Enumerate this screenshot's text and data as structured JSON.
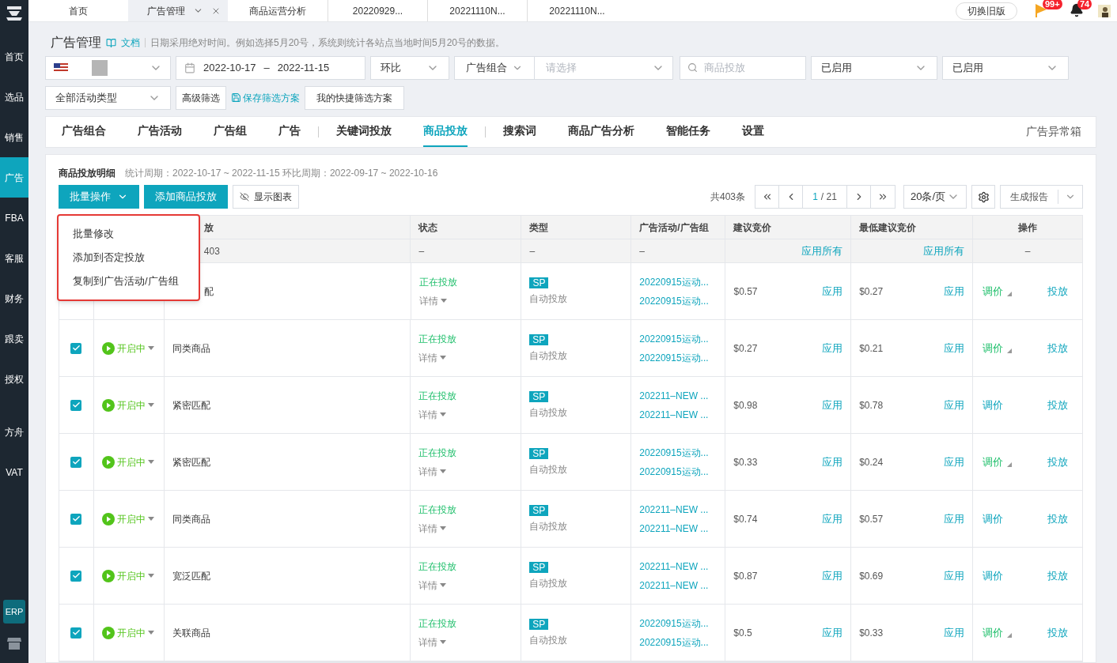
{
  "sidebar": {
    "items": [
      {
        "label": "首页",
        "selected": false
      },
      {
        "label": "选品",
        "selected": false
      },
      {
        "label": "销售",
        "selected": false
      },
      {
        "label": "广告",
        "selected": true
      },
      {
        "label": "FBA",
        "selected": false
      },
      {
        "label": "客服",
        "selected": false
      },
      {
        "label": "财务",
        "selected": false
      },
      {
        "label": "跟卖",
        "selected": false
      },
      {
        "label": "授权",
        "selected": false
      },
      {
        "label": "方舟",
        "selected": false
      },
      {
        "label": "VAT",
        "selected": false
      }
    ],
    "bottom_badge": "ERP"
  },
  "top_tabs": [
    {
      "label": "首页",
      "selected": false
    },
    {
      "label": "广告管理",
      "selected": true
    },
    {
      "label": "商品运营分析",
      "selected": false
    },
    {
      "label": "20220929...",
      "selected": false
    },
    {
      "label": "20221110N...",
      "selected": false
    },
    {
      "label": "20221110N...",
      "selected": false
    }
  ],
  "top_right": {
    "switch_button": "切换旧版",
    "flag_badge": "99+",
    "bell_badge": "74"
  },
  "header": {
    "title": "广告管理",
    "doc_link": "文档",
    "note": "日期采用绝对时间。例如选择5月20号，系统则统计各站点当地时间5月20号的数据。"
  },
  "filters": {
    "date_start": "2022-10-17",
    "date_sep": "–",
    "date_end": "2022-11-15",
    "compare": "环比",
    "group_label": "广告组合",
    "group_placeholder": "请选择",
    "search_placeholder": "商品投放",
    "status_1": "已启用",
    "status_2": "已启用",
    "activity_type": "全部活动类型",
    "advanced": "高级筛选",
    "save_scheme": "保存筛选方案",
    "my_schemes": "我的快捷筛选方案"
  },
  "nav_tabs": [
    {
      "label": "广告组合",
      "selected": false
    },
    {
      "label": "广告活动",
      "selected": false
    },
    {
      "label": "广告组",
      "selected": false
    },
    {
      "label": "广告",
      "selected": false
    },
    {
      "label": "关键词投放",
      "selected": false
    },
    {
      "label": "商品投放",
      "selected": true
    },
    {
      "label": "搜索词",
      "selected": false
    },
    {
      "label": "商品广告分析",
      "selected": false
    },
    {
      "label": "智能任务",
      "selected": false
    },
    {
      "label": "设置",
      "selected": false
    }
  ],
  "nav_right": "广告异常箱",
  "panel": {
    "title": "商品投放明细",
    "period": "统计周期：2022-10-17 ~ 2022-11-15 环比周期：2022-09-17 ~ 2022-10-16",
    "batch_button": "批量操作",
    "add_button": "添加商品投放",
    "chart_button": "显示图表",
    "total": "共403条",
    "page": "1",
    "pages": "/ 21",
    "page_size": "20条/页",
    "report_button": "生成报告"
  },
  "batch_menu": {
    "expanded": true,
    "items": [
      "批量修改",
      "添加到否定投放",
      "复制到广告活动/广告组"
    ]
  },
  "table": {
    "columns": [
      "放",
      "状态",
      "类型",
      "广告活动/广告组",
      "建议竞价",
      "最低建议竞价",
      "操作"
    ],
    "summary": [
      "403",
      "–",
      "–",
      "–",
      "应用所有",
      "应用所有",
      "–"
    ],
    "rows": [
      {
        "target": "配",
        "status": "正在投放",
        "detail": "详情",
        "type": "SP",
        "mode": "自动投放",
        "campaigns": [
          "20220915运动...",
          "20220915运动..."
        ],
        "bid": "$0.57",
        "bid_action": "应用",
        "min_bid": "$0.27",
        "min_action": "应用",
        "adjust": "调价",
        "adjusted": true,
        "launch": "投放"
      },
      {
        "checked": true,
        "toggle": "开启中",
        "enabled": true,
        "target": "同类商品",
        "status": "正在投放",
        "detail": "详情",
        "type": "SP",
        "mode": "自动投放",
        "campaigns": [
          "20220915运动...",
          "20220915运动..."
        ],
        "bid": "$0.27",
        "bid_action": "应用",
        "min_bid": "$0.21",
        "min_action": "应用",
        "adjust": "调价",
        "adjusted": true,
        "launch": "投放"
      },
      {
        "checked": true,
        "toggle": "开启中",
        "enabled": true,
        "target": "紧密匹配",
        "status": "正在投放",
        "detail": "详情",
        "type": "SP",
        "mode": "自动投放",
        "campaigns": [
          "202211–NEW ...",
          "202211–NEW ..."
        ],
        "bid": "$0.98",
        "bid_action": "应用",
        "min_bid": "$0.78",
        "min_action": "应用",
        "adjust": "调价",
        "adjusted": false,
        "launch": "投放"
      },
      {
        "checked": true,
        "toggle": "开启中",
        "enabled": true,
        "target": "紧密匹配",
        "status": "正在投放",
        "detail": "详情",
        "type": "SP",
        "mode": "自动投放",
        "campaigns": [
          "20220915运动...",
          "20220915运动..."
        ],
        "bid": "$0.33",
        "bid_action": "应用",
        "min_bid": "$0.24",
        "min_action": "应用",
        "adjust": "调价",
        "adjusted": true,
        "launch": "投放"
      },
      {
        "checked": true,
        "toggle": "开启中",
        "enabled": true,
        "target": "同类商品",
        "status": "正在投放",
        "detail": "详情",
        "type": "SP",
        "mode": "自动投放",
        "campaigns": [
          "202211–NEW ...",
          "202211–NEW ..."
        ],
        "bid": "$0.74",
        "bid_action": "应用",
        "min_bid": "$0.57",
        "min_action": "应用",
        "adjust": "调价",
        "adjusted": false,
        "launch": "投放"
      },
      {
        "checked": true,
        "toggle": "开启中",
        "enabled": true,
        "target": "宽泛匹配",
        "status": "正在投放",
        "detail": "详情",
        "type": "SP",
        "mode": "自动投放",
        "campaigns": [
          "202211–NEW ...",
          "202211–NEW ..."
        ],
        "bid": "$0.87",
        "bid_action": "应用",
        "min_bid": "$0.69",
        "min_action": "应用",
        "adjust": "调价",
        "adjusted": false,
        "launch": "投放"
      },
      {
        "checked": true,
        "toggle": "开启中",
        "enabled": true,
        "target": "关联商品",
        "status": "正在投放",
        "detail": "详情",
        "type": "SP",
        "mode": "自动投放",
        "campaigns": [
          "20220915运动...",
          "20220915运动..."
        ],
        "bid": "$0.5",
        "bid_action": "应用",
        "min_bid": "$0.33",
        "min_action": "应用",
        "adjust": "调价",
        "adjusted": true,
        "launch": "投放"
      }
    ]
  }
}
